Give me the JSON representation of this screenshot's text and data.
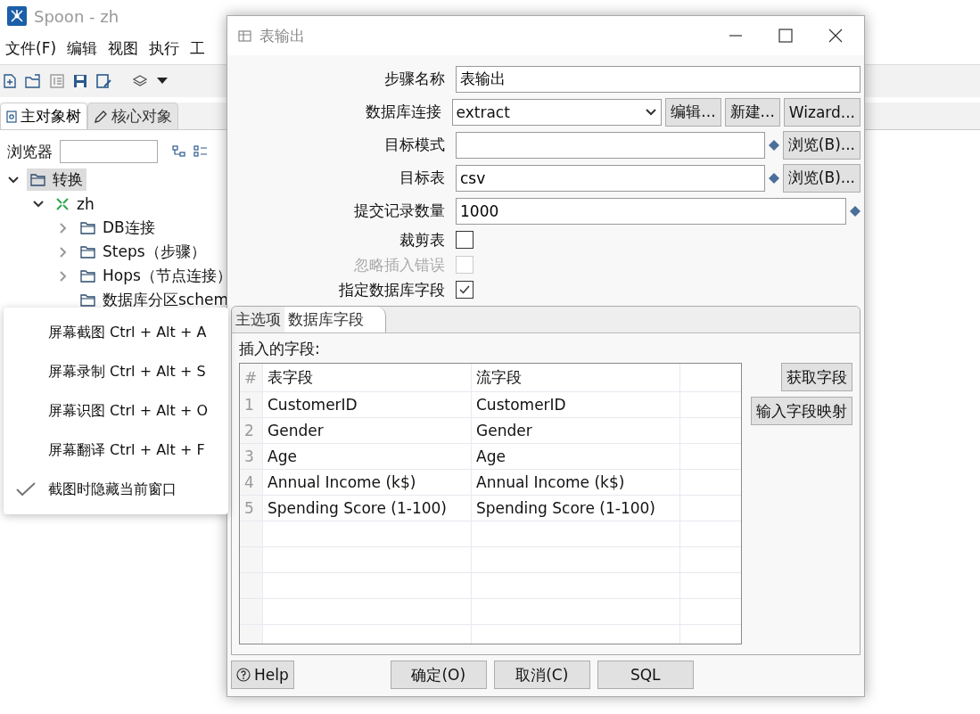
{
  "app": {
    "title": "Spoon - zh",
    "menu": [
      "文件(F)",
      "编辑",
      "视图",
      "执行",
      "工"
    ],
    "panel_tabs": [
      {
        "label": "主对象树",
        "selected": true
      },
      {
        "label": "核心对象",
        "selected": false
      }
    ],
    "browser": {
      "label": "浏览器"
    },
    "tree": [
      {
        "label": "转换",
        "selected": true,
        "expanded": true,
        "children": [
          {
            "label": "zh",
            "selected": false,
            "expanded": true,
            "children": [
              {
                "label": "DB连接",
                "selected": false,
                "expanded": false
              },
              {
                "label": "Steps（步骤）",
                "selected": false,
                "expanded": false
              },
              {
                "label": "Hops（节点连接）",
                "selected": false,
                "expanded": false
              },
              {
                "label": "数据库分区schem",
                "selected": false
              }
            ]
          }
        ]
      }
    ]
  },
  "dialog": {
    "title": "表输出",
    "fields": [
      {
        "kind": "text",
        "label": "步骤名称",
        "value": "表输出"
      },
      {
        "kind": "select",
        "label": "数据库连接",
        "value": "extract",
        "buttons": [
          "编辑...",
          "新建...",
          "Wizard..."
        ]
      },
      {
        "kind": "variable",
        "label": "目标模式",
        "buttons": [
          "浏览(B)..."
        ]
      },
      {
        "kind": "variable",
        "label": "目标表",
        "value": "csv",
        "buttons": [
          "浏览(B)..."
        ]
      },
      {
        "kind": "variable",
        "label": "提交记录数量",
        "value": "1000"
      },
      {
        "kind": "checkbox",
        "label": "裁剪表",
        "checked": false,
        "disabled": false
      },
      {
        "kind": "checkbox",
        "label": "忽略插入错误",
        "checked": false,
        "disabled": true
      },
      {
        "kind": "checkbox",
        "label": "指定数据库字段",
        "checked": true,
        "disabled": false
      }
    ],
    "tabs": [
      {
        "label": "主选项",
        "selected": false
      },
      {
        "label": "数据库字段",
        "selected": true
      }
    ],
    "table_label": "插入的字段:",
    "table": {
      "columns": [
        "#",
        "表字段",
        "流字段"
      ],
      "rows": [
        [
          "1",
          "CustomerID",
          "CustomerID"
        ],
        [
          "2",
          "Gender",
          "Gender"
        ],
        [
          "3",
          "Age",
          "Age"
        ],
        [
          "4",
          "Annual Income (k$)",
          "Annual Income (k$)"
        ],
        [
          "5",
          "Spending Score (1-100)",
          "Spending Score (1-100)"
        ]
      ]
    },
    "side_buttons": [
      "获取字段",
      "输入字段映射"
    ],
    "help": "Help",
    "buttons": [
      "确定(O)",
      "取消(C)",
      "SQL"
    ]
  },
  "context_menu": [
    {
      "label": "屏幕截图 Ctrl + Alt + A",
      "checked": false
    },
    {
      "label": "屏幕录制 Ctrl + Alt + S",
      "checked": false
    },
    {
      "label": "屏幕识图 Ctrl + Alt + O",
      "checked": false
    },
    {
      "label": "屏幕翻译 Ctrl + Alt + F",
      "checked": false
    },
    {
      "label": "截图时隐藏当前窗口",
      "checked": true
    }
  ]
}
